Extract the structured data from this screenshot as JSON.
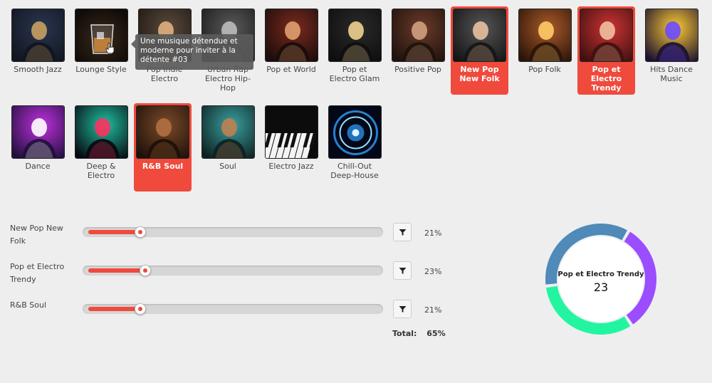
{
  "genres": [
    {
      "label": "Smooth Jazz",
      "selected": false,
      "icon": "saxophone-player-image"
    },
    {
      "label": "Lounge Style",
      "selected": false,
      "icon": "whiskey-glass-image"
    },
    {
      "label": "Pop Indie Electro",
      "selected": false,
      "icon": "headphones-singer-image"
    },
    {
      "label": "Urban Rap Electro Hip-Hop",
      "selected": false,
      "icon": "rapper-image"
    },
    {
      "label": "Pop et World",
      "selected": false,
      "icon": "rock-singer-image"
    },
    {
      "label": "Pop et Electro Glam",
      "selected": false,
      "icon": "blonde-singer-image"
    },
    {
      "label": "Positive Pop",
      "selected": false,
      "icon": "guitarist-image"
    },
    {
      "label": "New Pop New Folk",
      "selected": true,
      "icon": "female-singer-image"
    },
    {
      "label": "Pop Folk",
      "selected": false,
      "icon": "band-stage-image"
    },
    {
      "label": "Pop et Electro Trendy",
      "selected": true,
      "icon": "singer-microphone-image"
    },
    {
      "label": "Hits Dance Music",
      "selected": false,
      "icon": "concert-crowd-image"
    },
    {
      "label": "Dance",
      "selected": false,
      "icon": "dj-image"
    },
    {
      "label": "Deep & Electro",
      "selected": false,
      "icon": "neon-headphones-image"
    },
    {
      "label": "R&B Soul",
      "selected": true,
      "icon": "soul-singer-image"
    },
    {
      "label": "Soul",
      "selected": false,
      "icon": "soul-performer-image"
    },
    {
      "label": "Electro Jazz",
      "selected": false,
      "icon": "piano-keys-image"
    },
    {
      "label": "Chill-Out Deep-House",
      "selected": false,
      "icon": "speaker-glow-image"
    }
  ],
  "tooltip": {
    "text": "Une musique détendue et moderne pour inviter à la détente #03"
  },
  "mix": {
    "rows": [
      {
        "label": "New Pop New Folk",
        "value": 21,
        "display": "21%",
        "filter_icon": "filter-icon"
      },
      {
        "label": "Pop et Electro Trendy",
        "value": 23,
        "display": "23%",
        "filter_icon": "filter-icon"
      },
      {
        "label": "R&B Soul",
        "value": 21,
        "display": "21%",
        "filter_icon": "filter-icon"
      }
    ],
    "total_label": "Total:",
    "total_value": "65%"
  },
  "donut": {
    "center_title": "Pop et Electro Trendy",
    "center_value": "23",
    "segments": [
      {
        "name": "New Pop New Folk",
        "value": 21,
        "color": "#22f5a0"
      },
      {
        "name": "Pop et Electro Trendy",
        "value": 23,
        "color": "#4f8ab8"
      },
      {
        "name": "R&B Soul",
        "value": 21,
        "color": "#9b4dff"
      }
    ]
  },
  "colors": {
    "accent": "#ef4a3c",
    "background": "#eeeeef"
  }
}
